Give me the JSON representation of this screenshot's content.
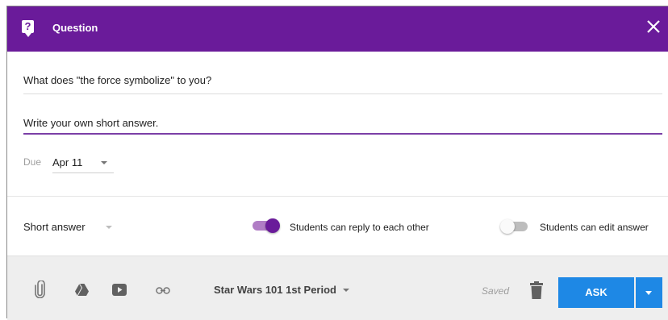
{
  "header": {
    "title": "Question",
    "icon": "question-bubble-icon",
    "close_icon": "close-icon",
    "accent_color": "#6a1b9a"
  },
  "form": {
    "question_text": "What does \"the force symbolize\" to you?",
    "answer_text": "Write your own short answer.",
    "due_label": "Due",
    "due_value": "Apr 11"
  },
  "options": {
    "type_value": "Short answer",
    "reply_label": "Students can reply to each other",
    "reply_enabled": true,
    "edit_label": "Students can edit answer",
    "edit_enabled": false
  },
  "footer": {
    "icons": [
      "paperclip-icon",
      "google-drive-icon",
      "youtube-icon",
      "link-icon"
    ],
    "class_name": "Star Wars 101 1st Period",
    "status": "Saved",
    "ask_label": "ASK",
    "button_color": "#1e88e5"
  }
}
